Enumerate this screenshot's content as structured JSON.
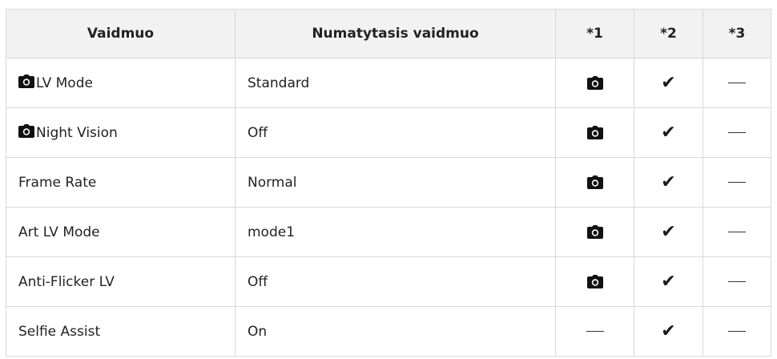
{
  "headers": {
    "mode": "Vaidmuo",
    "default": "Numatytasis vaidmuo",
    "c1": "*1",
    "c2": "*2",
    "c3": "*3"
  },
  "rows": [
    {
      "name": "LV Mode",
      "name_icon": "camera-icon",
      "default": "Standard",
      "c1": "camera-icon",
      "c2": "check-icon",
      "c3": "dash-icon"
    },
    {
      "name": "Night Vision",
      "name_icon": "camera-icon",
      "default": "Off",
      "c1": "camera-icon",
      "c2": "check-icon",
      "c3": "dash-icon"
    },
    {
      "name": "Frame Rate",
      "default": "Normal",
      "c1": "camera-icon",
      "c2": "check-icon",
      "c3": "dash-icon"
    },
    {
      "name": "Art LV Mode",
      "default": "mode1",
      "c1": "camera-icon",
      "c2": "check-icon",
      "c3": "dash-icon"
    },
    {
      "name": "Anti-Flicker LV",
      "default": "Off",
      "c1": "camera-icon",
      "c2": "check-icon",
      "c3": "dash-icon"
    },
    {
      "name": "Selfie Assist",
      "default": "On",
      "c1": "dash-icon",
      "c2": "check-icon",
      "c3": "dash-icon"
    }
  ]
}
